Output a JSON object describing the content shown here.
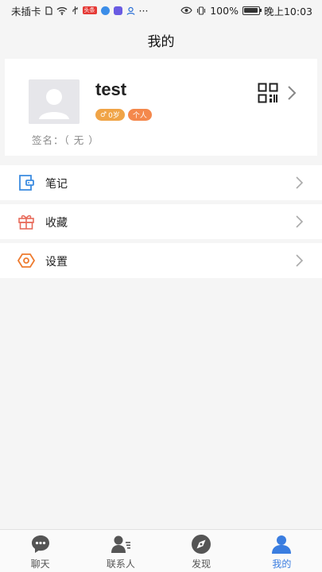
{
  "status_bar": {
    "carrier": "未插卡",
    "battery": "100%",
    "time": "晚上10:03",
    "badge_text": "头条",
    "more": "···"
  },
  "header": {
    "title": "我的"
  },
  "profile": {
    "username": "test",
    "gender_icon": "male-symbol",
    "gender_glyph": "♂",
    "age": "0岁",
    "type": "个人",
    "signature_label": "签名：",
    "signature_value": "（ 无 ）"
  },
  "menu": [
    {
      "label": "笔记",
      "icon": "notebook-icon",
      "color": "#3a8be0"
    },
    {
      "label": "收藏",
      "icon": "gift-icon",
      "color": "#e86a5a"
    },
    {
      "label": "设置",
      "icon": "settings-hexagon-icon",
      "color": "#ee7b2f"
    }
  ],
  "bottom_nav": [
    {
      "label": "聊天",
      "icon": "chat-bubble-icon",
      "active": false
    },
    {
      "label": "联系人",
      "icon": "contacts-icon",
      "active": false
    },
    {
      "label": "发现",
      "icon": "compass-icon",
      "active": false
    },
    {
      "label": "我的",
      "icon": "person-icon",
      "active": true
    }
  ],
  "colors": {
    "accent": "#3a7de0",
    "inactive_icon": "#555555",
    "tag_gender": "#f0a447",
    "tag_type": "#f4884c"
  }
}
